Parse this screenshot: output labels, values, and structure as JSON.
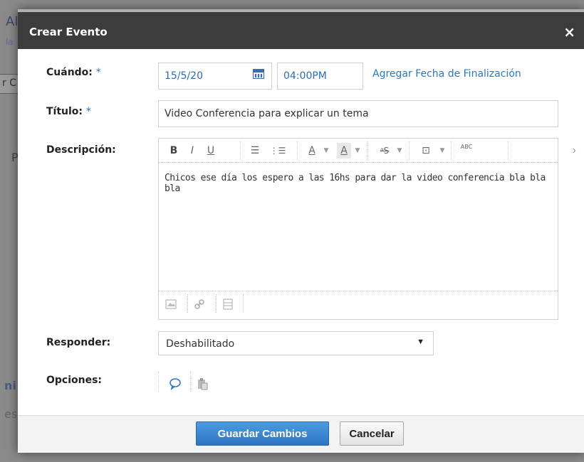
{
  "background": {
    "fragments": [
      "Al",
      "la",
      "r C",
      "P",
      "ni",
      "es"
    ]
  },
  "dialog": {
    "title": "Crear Evento",
    "close_glyph": "×"
  },
  "form": {
    "when": {
      "label": "Cuándo:",
      "required_mark": "*",
      "date": "15/5/20",
      "time": "04:00PM",
      "add_end_link": "Agregar Fecha de Finalización"
    },
    "title": {
      "label": "Título:",
      "required_mark": "*",
      "value": "Video Conferencia para explicar un tema"
    },
    "description": {
      "label": "Descripción:",
      "toolbar": {
        "bold": "B",
        "italic": "I",
        "underline": "U",
        "bullets": "☰",
        "numbered": "⋮☰",
        "font_color": "A",
        "bg_color": "A",
        "format": "ᵃS",
        "insert": "⊡",
        "spell": "ABC",
        "more": "›",
        "caret": "▼"
      },
      "body": "Chicos ese día los espero a las 16hs para dar la video conferencia bla bla bla"
    },
    "responder": {
      "label": "Responder:",
      "value": "Deshabilitado",
      "arrow": "▼"
    },
    "options": {
      "label": "Opciones:"
    }
  },
  "footer": {
    "save_label": "Guardar Cambios",
    "cancel_label": "Cancelar"
  },
  "colors": {
    "accent": "#2a78c2",
    "titlebar": "#3c3c3c",
    "primary_button": "#2c74c4"
  }
}
